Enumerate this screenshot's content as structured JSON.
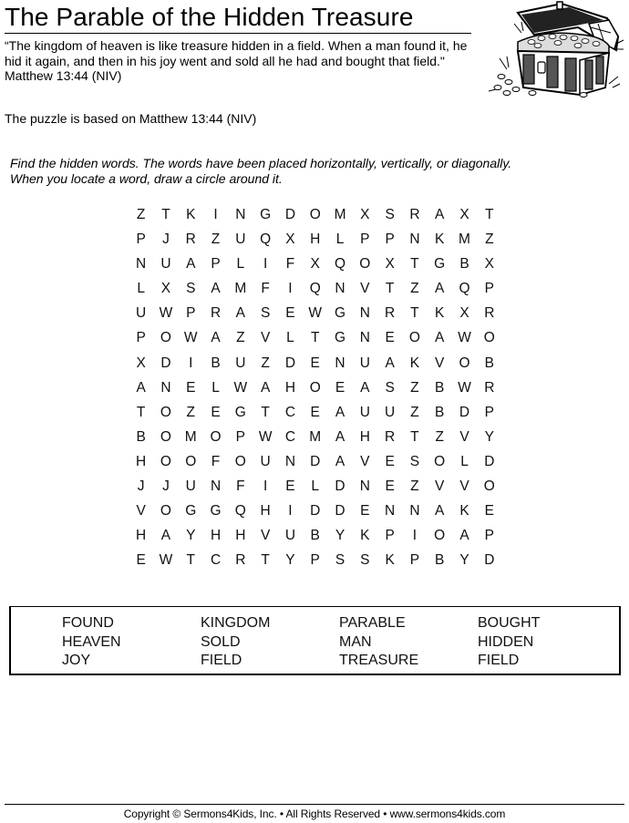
{
  "header": {
    "title": "The Parable of the Hidden Treasure",
    "verse": "“The kingdom of heaven is like treasure hidden in a field. When a man found it, he hid it again, and then in his joy went and sold all he had and bought that field.\" Matthew 13:44 (NIV)",
    "illustration_icon": "treasure-chest-icon"
  },
  "based_on": "The puzzle is based on Matthew 13:44 (NIV)",
  "instructions": {
    "line1": "Find the hidden words. The words have been placed horizontally, vertically, or diagonally.",
    "line2": "When you locate a word, draw a circle around it."
  },
  "puzzle": {
    "rows": [
      "ZTKINGDOMXSRAXT",
      "PJRZUQXHLPPNKMZ",
      "NUAPLIFXQOXTGBX",
      "LXSAMFIQNVTZAQP",
      "UWPRASEWGNRTKXR",
      "POWAZVLTGNEOAWO",
      "XDIBUZDENUAKVOB",
      "ANELWAHOEASZBWR",
      "TOZEGTCEAUUZBDP",
      "BOMOPWCMAHRTZVY",
      "HOOFOUNDAVESOLD",
      "JJUNFIELDNEZVVO",
      "VOGGQHIDDENNAKE",
      "HAYHHVUBYKPIOAP",
      "EWTCRTYPSSKPBYD"
    ]
  },
  "word_bank": {
    "columns": [
      [
        "FOUND",
        "HEAVEN",
        "JOY"
      ],
      [
        "KINGDOM",
        "SOLD",
        "FIELD"
      ],
      [
        "PARABLE",
        "MAN",
        "TREASURE"
      ],
      [
        "BOUGHT",
        "HIDDEN",
        "FIELD"
      ]
    ]
  },
  "footer": {
    "copyright": "Copyright © Sermons4Kids, Inc. • All Rights Reserved • www.sermons4kids.com"
  }
}
